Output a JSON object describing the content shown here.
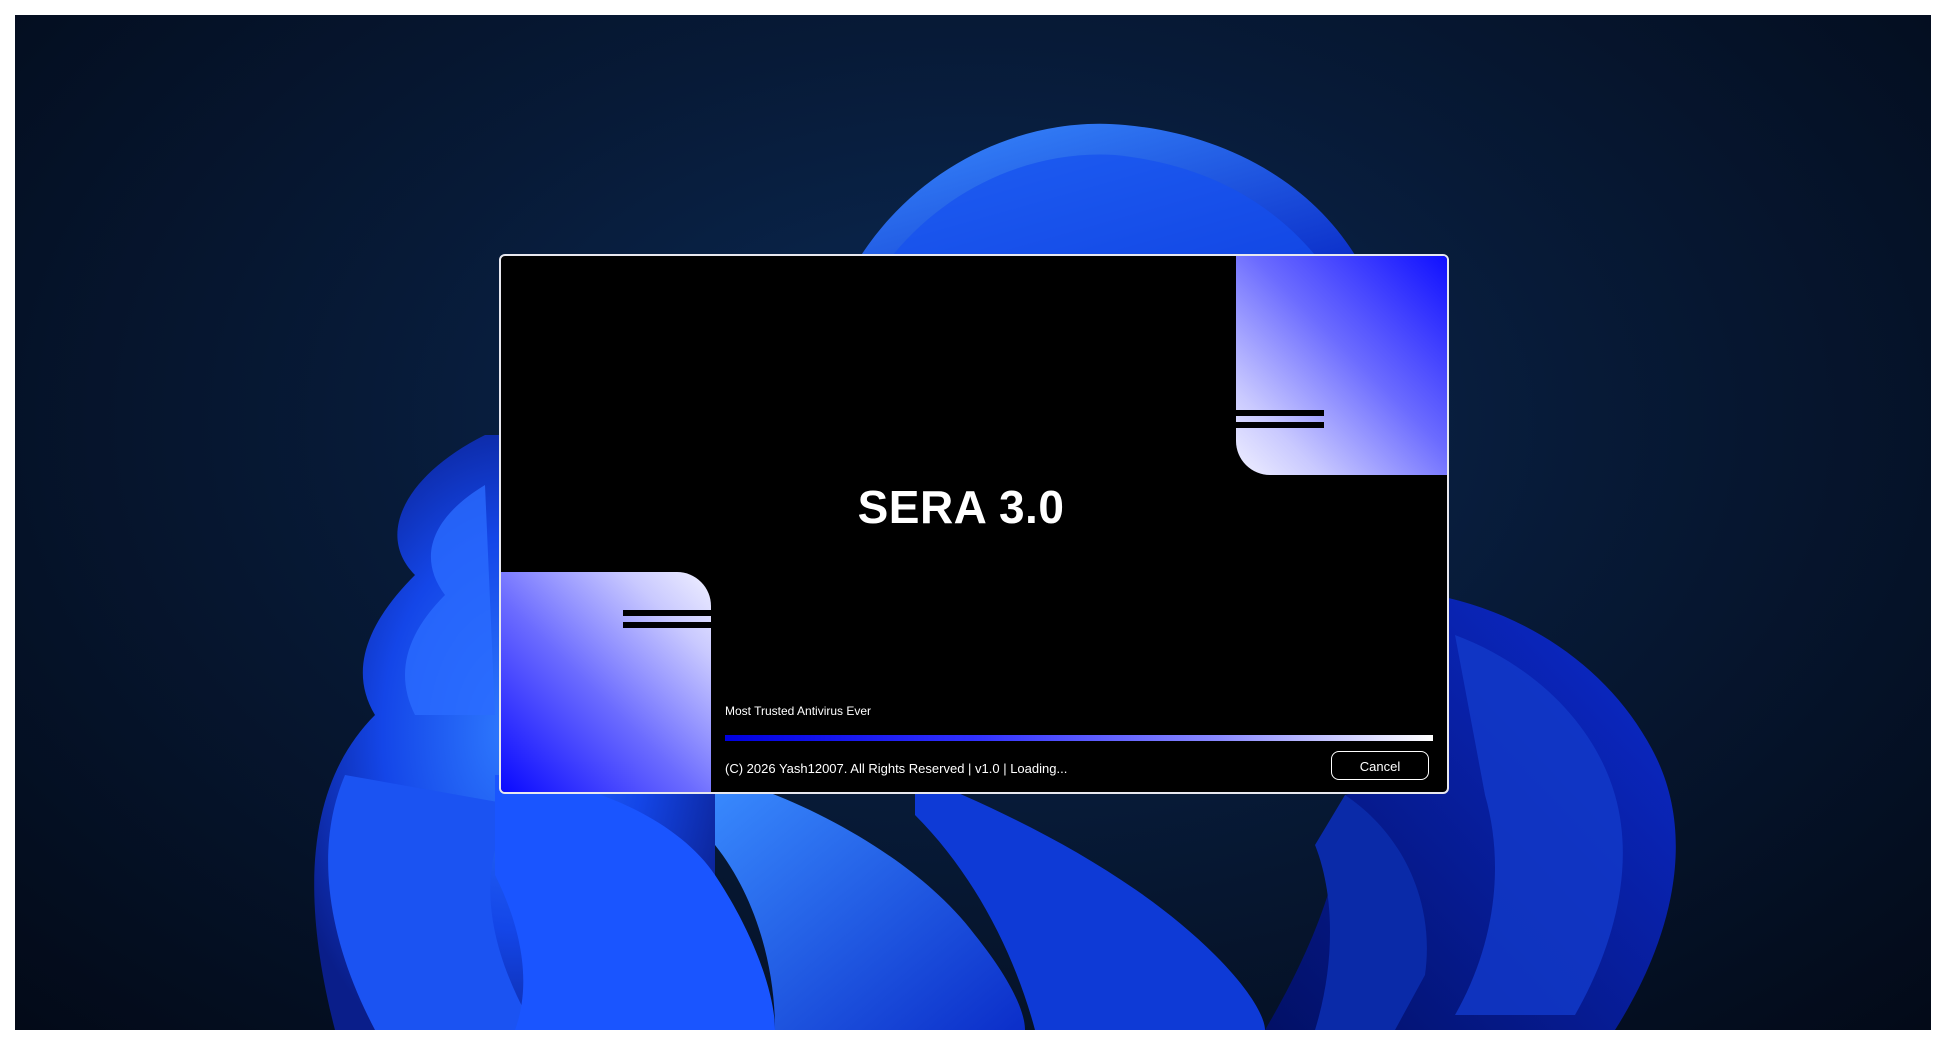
{
  "splash": {
    "title": "SERA 3.0",
    "tagline": "Most Trusted Antivirus Ever",
    "footer": "(C) 2026 Yash12007. All Rights Reserved | v1.0 | Loading...",
    "progress": 1.0,
    "cancel_label": "Cancel"
  },
  "colors": {
    "accent": "#1010ff",
    "background": "#000000",
    "text": "#ffffff"
  }
}
